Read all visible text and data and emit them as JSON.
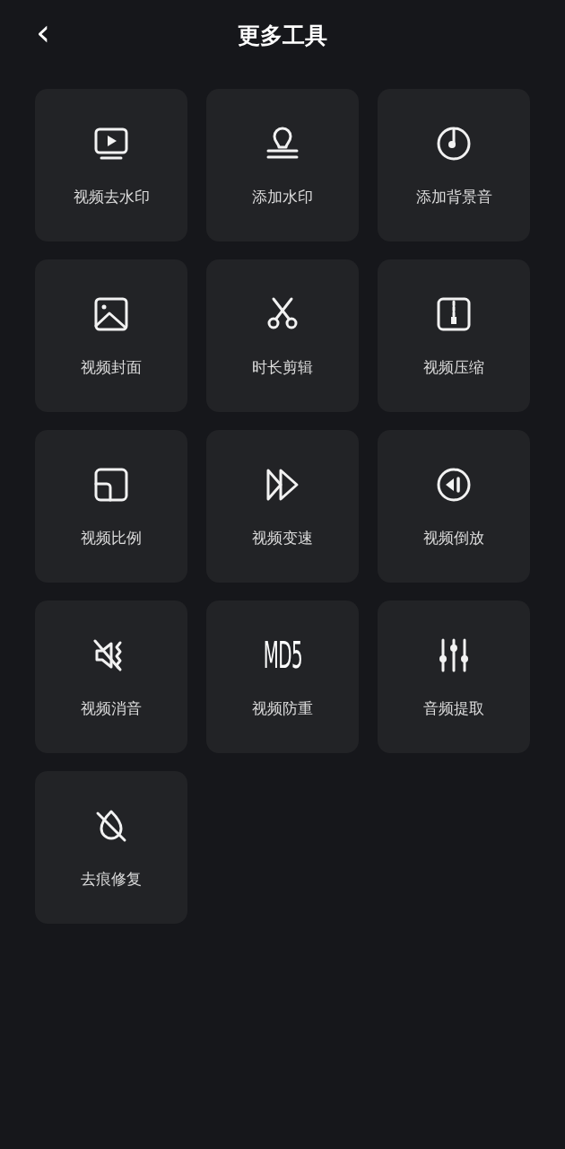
{
  "header": {
    "back": "‹",
    "title": "更多工具"
  },
  "tools": [
    {
      "kind": "icon",
      "label": "视频去水印"
    },
    {
      "kind": "icon",
      "label": "添加水印"
    },
    {
      "kind": "icon",
      "label": "添加背景音"
    },
    {
      "kind": "icon",
      "label": "视频封面"
    },
    {
      "kind": "icon",
      "label": "时长剪辑"
    },
    {
      "kind": "icon",
      "label": "视频压缩"
    },
    {
      "kind": "icon",
      "label": "视频比例"
    },
    {
      "kind": "icon",
      "label": "视频变速"
    },
    {
      "kind": "icon",
      "label": "视频倒放"
    },
    {
      "kind": "icon",
      "label": "视频消音"
    },
    {
      "kind": "glyph",
      "label": "视频防重"
    },
    {
      "kind": "icon",
      "label": "音频提取"
    },
    {
      "kind": "icon",
      "label": "去痕修复"
    }
  ],
  "glyph_icon_text": "MD5"
}
